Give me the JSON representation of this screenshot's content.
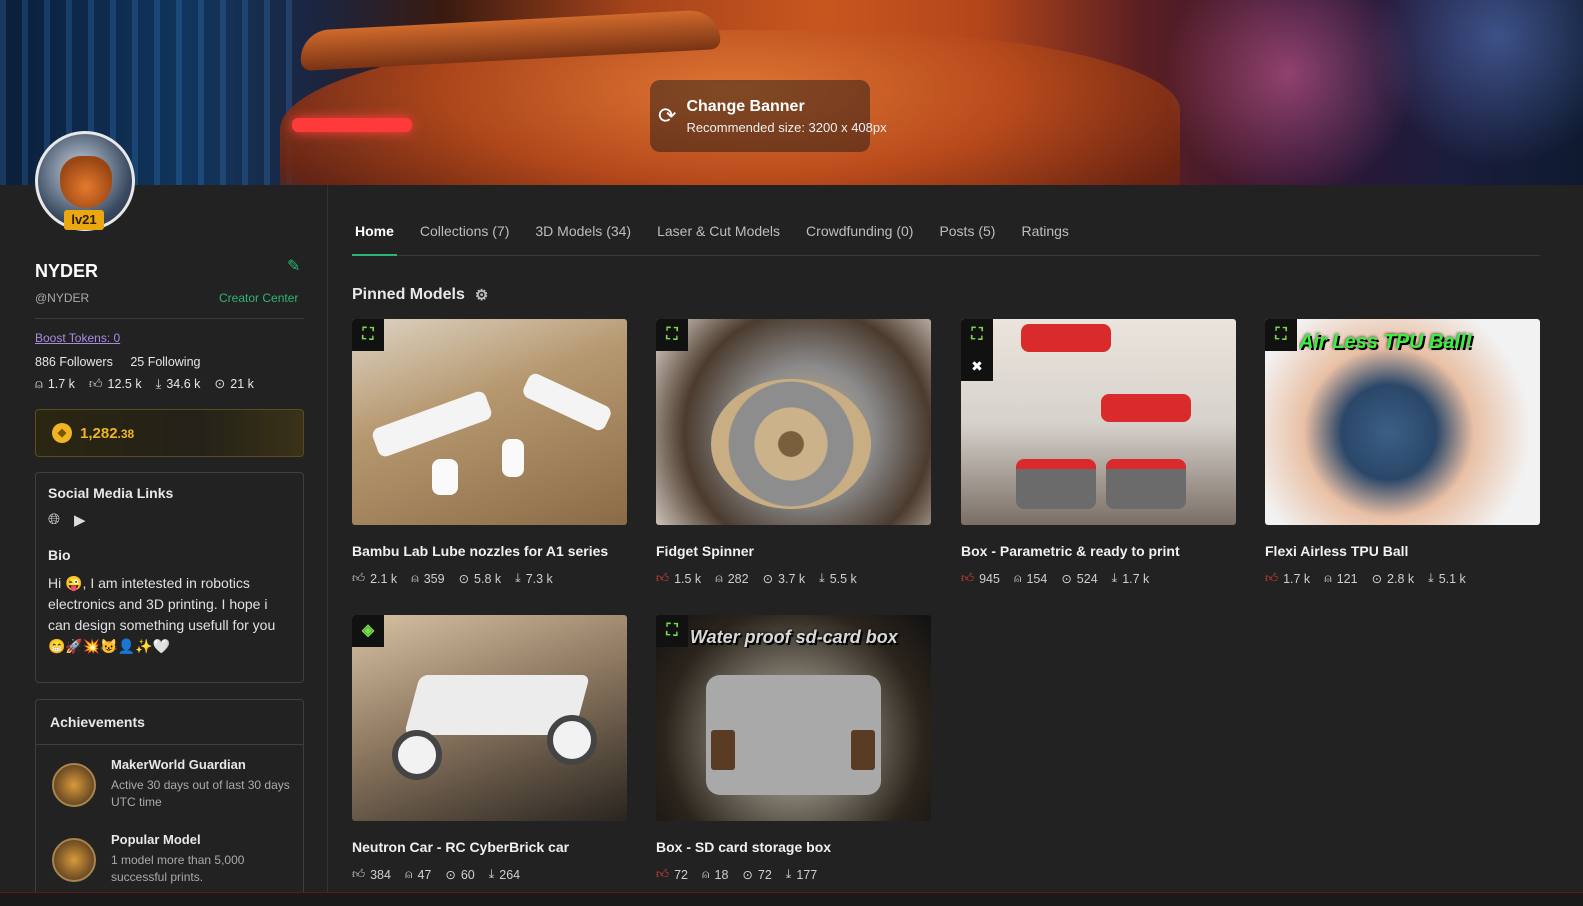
{
  "banner": {
    "change_label": "Change Banner",
    "size_hint": "Recommended size: 3200 x 408px"
  },
  "profile": {
    "level": "lv21",
    "name": "NYDER",
    "handle": "@NYDER",
    "creator_center": "Creator Center",
    "boost_tokens": "Boost Tokens: 0",
    "followers": "886 Followers",
    "following": "25 Following",
    "stats": {
      "prints": "1.7 k",
      "likes": "12.5 k",
      "downloads": "34.6 k",
      "views": "21 k"
    },
    "points_main": "1,282",
    "points_frac": ".38",
    "social_title": "Social Media Links",
    "bio_title": "Bio",
    "bio_text": "Hi 😜, I am intetested in robotics electronics and 3D printing. I hope i can design something usefull for you 😁🚀💥😺👤✨🤍"
  },
  "achievements": {
    "title": "Achievements",
    "items": [
      {
        "name": "MakerWorld Guardian",
        "desc": "Active 30 days out of last 30 days UTC time"
      },
      {
        "name": "Popular Model",
        "desc": "1 model more than 5,000 successful prints."
      }
    ]
  },
  "tabs": [
    "Home",
    "Collections (7)",
    "3D Models (34)",
    "Laser & Cut Models",
    "Crowdfunding (0)",
    "Posts (5)",
    "Ratings"
  ],
  "pinned_title": "Pinned Models",
  "models": [
    {
      "title": "Bambu Lab Lube nozzles for A1 series",
      "likes": "2.1 k",
      "prints": "359",
      "views": "5.8 k",
      "downloads": "7.3 k"
    },
    {
      "title": "Fidget Spinner",
      "likes": "1.5 k",
      "prints": "282",
      "views": "3.7 k",
      "downloads": "5.5 k"
    },
    {
      "title": "Box - Parametric & ready to print",
      "likes": "945",
      "prints": "154",
      "views": "524",
      "downloads": "1.7 k"
    },
    {
      "title": "Flexi Airless TPU Ball",
      "likes": "1.7 k",
      "prints": "121",
      "views": "2.8 k",
      "downloads": "5.1 k",
      "overlay": "Air Less TPU Ball!"
    },
    {
      "title": "Neutron Car - RC CyberBrick car",
      "likes": "384",
      "prints": "47",
      "views": "60",
      "downloads": "264"
    },
    {
      "title": "Box - SD card storage box",
      "likes": "72",
      "prints": "18",
      "views": "72",
      "downloads": "177",
      "overlay": "Water proof sd-card box"
    }
  ]
}
